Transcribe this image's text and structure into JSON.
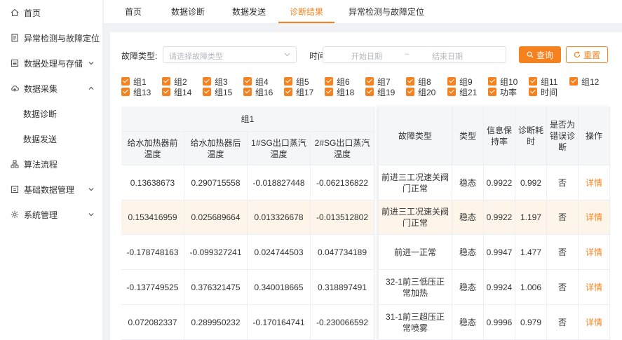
{
  "sidebar": {
    "items": [
      {
        "label": "首页",
        "icon": "home-icon"
      },
      {
        "label": "异常检测与故障定位",
        "icon": "file-icon"
      },
      {
        "label": "数据处理与存储",
        "icon": "list-icon"
      },
      {
        "label": "数据采集",
        "icon": "cloud-icon"
      },
      {
        "label": "数据诊断",
        "icon": ""
      },
      {
        "label": "数据发送",
        "icon": ""
      },
      {
        "label": "算法流程",
        "icon": "flow-icon"
      },
      {
        "label": "基础数据管理",
        "icon": "database-icon"
      },
      {
        "label": "系统管理",
        "icon": "gear-icon"
      }
    ]
  },
  "tabs": [
    "首页",
    "数据诊断",
    "数据发送",
    "诊断结果",
    "异常检测与故障定位"
  ],
  "active_tab": "诊断结果",
  "filters": {
    "fault_type_label": "故障类型:",
    "fault_type_placeholder": "请选择故障类型",
    "time_label": "时间",
    "start_placeholder": "开始日期",
    "separator": "~",
    "end_placeholder": "结束日期",
    "query_label": "查询",
    "reset_label": "重置"
  },
  "checkboxes": [
    "组1",
    "组2",
    "组3",
    "组4",
    "组5",
    "组6",
    "组7",
    "组8",
    "组9",
    "组10",
    "组11",
    "组12",
    "组13",
    "组14",
    "组15",
    "组16",
    "组17",
    "组18",
    "组19",
    "组20",
    "组21",
    "功率",
    "时间"
  ],
  "table": {
    "group_header": "组1",
    "left_headers": [
      "给水加热器前温度",
      "给水加热器后温度",
      "1#SG出口蒸汽温度",
      "2#SG出口蒸汽温度"
    ],
    "right_headers": [
      "故障类型",
      "类型",
      "信息保持率",
      "诊断耗时",
      "是否为错误诊断",
      "操作"
    ],
    "rows": [
      {
        "v1": "0.13638673",
        "v2": "0.290715558",
        "v3": "-0.018827448",
        "v4": "-0.062136822",
        "fault": "前进三工况速关阀门正常",
        "type": "稳态",
        "retention": "0.9922",
        "time": "0.992",
        "error": "否",
        "action": "详情"
      },
      {
        "v1": "0.153416959",
        "v2": "0.025689664",
        "v3": "0.013326678",
        "v4": "-0.013512802",
        "fault": "前进三工况速关阀门正常",
        "type": "稳态",
        "retention": "0.9922",
        "time": "1.197",
        "error": "否",
        "action": "详情"
      },
      {
        "v1": "-0.178748163",
        "v2": "-0.099327241",
        "v3": "0.024744503",
        "v4": "0.047734189",
        "fault": "前进一正常",
        "type": "稳态",
        "retention": "0.9947",
        "time": "1.477",
        "error": "否",
        "action": "详情"
      },
      {
        "v1": "-0.137749525",
        "v2": "0.376321475",
        "v3": "0.340018665",
        "v4": "0.318897491",
        "fault": "32-1前三低压正常加热",
        "type": "稳态",
        "retention": "0.9924",
        "time": "1.006",
        "error": "否",
        "action": "详情"
      },
      {
        "v1": "0.072082337",
        "v2": "0.289950232",
        "v3": "-0.170164741",
        "v4": "-0.230066592",
        "fault": "31-1前三超压正常喷雾",
        "type": "稳态",
        "retention": "0.9996",
        "time": "0.979",
        "error": "否",
        "action": "详情"
      }
    ]
  },
  "colors": {
    "accent": "#f5821f",
    "highlight_row": "#fdf5ea",
    "header_bg": "#f5f6f8"
  }
}
